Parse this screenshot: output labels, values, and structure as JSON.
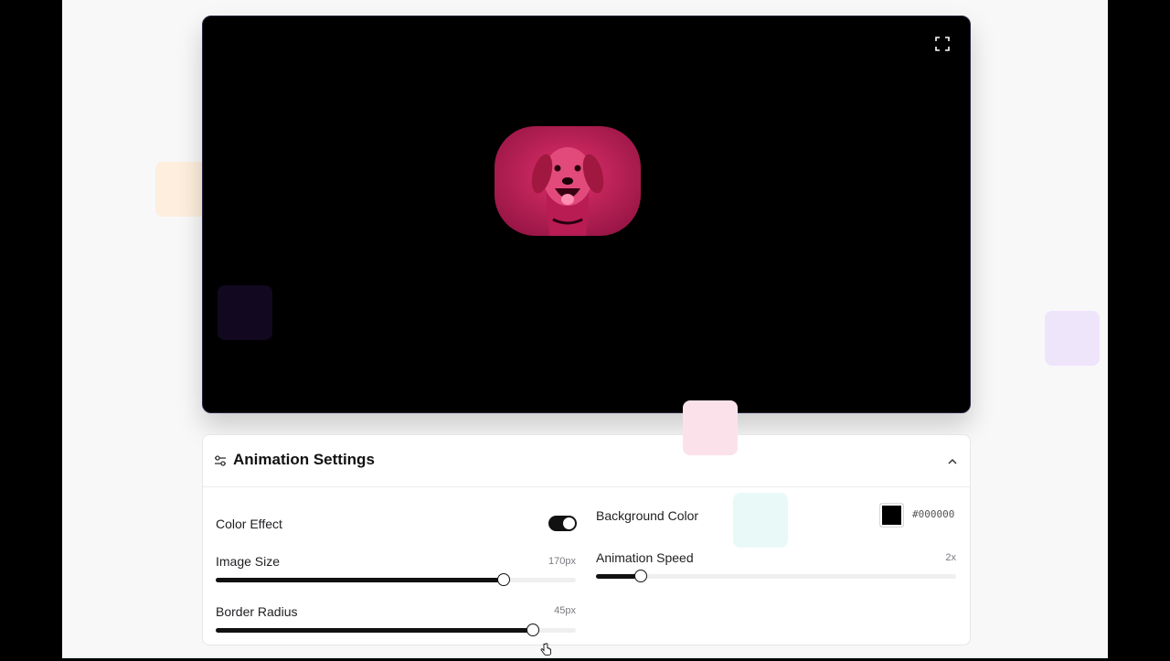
{
  "preview": {
    "fullscreen_icon": "fullscreen-icon",
    "image_alt": "dog",
    "background_color": "#000000",
    "tint_color": "#d21e5a"
  },
  "settings": {
    "icon": "sliders-icon",
    "title": "Animation Settings",
    "collapse_icon": "chevron-up-icon",
    "color_effect": {
      "label": "Color Effect",
      "enabled": true
    },
    "image_size": {
      "label": "Image Size",
      "value": "170px",
      "fraction": 0.8
    },
    "border_radius": {
      "label": "Border Radius",
      "value": "45px",
      "fraction": 0.88
    },
    "background_color": {
      "label": "Background Color",
      "hex": "#000000"
    },
    "animation_speed": {
      "label": "Animation Speed",
      "value": "2x",
      "fraction": 0.125
    }
  },
  "decor_colors": {
    "orange": "#fdeedd",
    "indigo": "#1a0a2a",
    "lavender": "#efe5fb",
    "pink": "#fbe2ea",
    "cyan": "#e9f9f8"
  }
}
